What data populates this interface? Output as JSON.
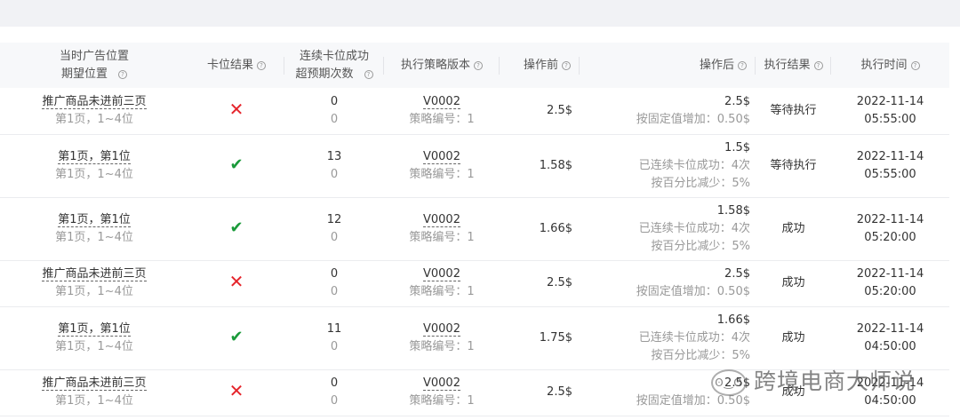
{
  "headers": [
    {
      "l1": "当时广告位置",
      "l2": "期望位置"
    },
    {
      "l1": "卡位结果"
    },
    {
      "l1": "连续卡位成功",
      "l2": "超预期次数"
    },
    {
      "l1": "执行策略版本"
    },
    {
      "l1": "操作前"
    },
    {
      "l1": "操作后"
    },
    {
      "l1": "执行结果"
    },
    {
      "l1": "执行时间"
    }
  ],
  "rows": [
    {
      "pos": "推广商品未进前三页",
      "expect": "第1页，1~4位",
      "result": "fail",
      "count": "0",
      "over": "0",
      "ver": "V0002",
      "strategy": "策略编号：1",
      "before": "2.5$",
      "after": "2.5$",
      "notes": [
        "按固定值增加：0.50$"
      ],
      "status": "等待执行",
      "date": "2022-11-14",
      "time": "05:55:00"
    },
    {
      "pos": "第1页，第1位",
      "expect": "第1页，1~4位",
      "result": "success",
      "count": "13",
      "over": "0",
      "ver": "V0002",
      "strategy": "策略编号：1",
      "before": "1.58$",
      "after": "1.5$",
      "notes": [
        "已连续卡位成功：4次",
        "按百分比减少：5%"
      ],
      "status": "等待执行",
      "date": "2022-11-14",
      "time": "05:55:00"
    },
    {
      "pos": "第1页，第1位",
      "expect": "第1页，1~4位",
      "result": "success",
      "count": "12",
      "over": "0",
      "ver": "V0002",
      "strategy": "策略编号：1",
      "before": "1.66$",
      "after": "1.58$",
      "notes": [
        "已连续卡位成功：4次",
        "按百分比减少：5%"
      ],
      "status": "成功",
      "date": "2022-11-14",
      "time": "05:20:00"
    },
    {
      "pos": "推广商品未进前三页",
      "expect": "第1页，1~4位",
      "result": "fail",
      "count": "0",
      "over": "0",
      "ver": "V0002",
      "strategy": "策略编号：1",
      "before": "2.5$",
      "after": "2.5$",
      "notes": [
        "按固定值增加：0.50$"
      ],
      "status": "成功",
      "date": "2022-11-14",
      "time": "05:20:00"
    },
    {
      "pos": "第1页，第1位",
      "expect": "第1页，1~4位",
      "result": "success",
      "count": "11",
      "over": "0",
      "ver": "V0002",
      "strategy": "策略编号：1",
      "before": "1.75$",
      "after": "1.66$",
      "notes": [
        "已连续卡位成功：4次",
        "按百分比减少：5%"
      ],
      "status": "成功",
      "date": "2022-11-14",
      "time": "04:50:00"
    },
    {
      "pos": "推广商品未进前三页",
      "expect": "第1页，1~4位",
      "result": "fail",
      "count": "0",
      "over": "0",
      "ver": "V0002",
      "strategy": "策略编号：1",
      "before": "2.5$",
      "after": "2.5$",
      "notes": [
        "按固定值增加：0.50$"
      ],
      "status": "成功",
      "date": "2022-11-14",
      "time": "04:50:00"
    }
  ],
  "watermark": "跨境电商大师说",
  "icons": {
    "fail": "✕",
    "success": "✔",
    "help": "?"
  }
}
